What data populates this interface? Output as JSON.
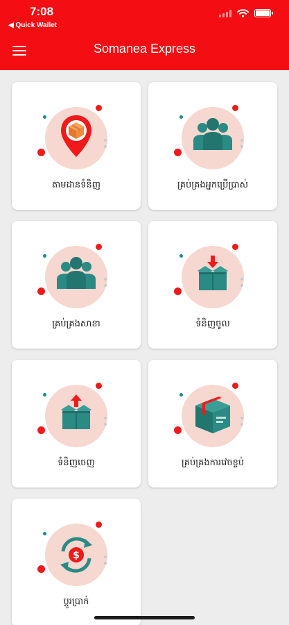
{
  "status_bar": {
    "time": "7:08",
    "back_app": "◀ Quick Wallet"
  },
  "header": {
    "title": "Somanea Express",
    "menu_icon": "hamburger-menu-icon"
  },
  "colors": {
    "brand_red": "#f40d12",
    "teal": "#2a8a84",
    "circle_bg": "#f6d8d0"
  },
  "menu": [
    {
      "label": "តាមដានទំនិញ",
      "icon": "parcel-location-icon"
    },
    {
      "label": "គ្រប់គ្រងអ្នកប្រើប្រាស់",
      "icon": "users-group-icon"
    },
    {
      "label": "គ្រប់គ្រងសាខា",
      "icon": "users-group-icon"
    },
    {
      "label": "ទំនិញចូល",
      "icon": "box-in-icon"
    },
    {
      "label": "ទំនិញចេញ",
      "icon": "box-out-icon"
    },
    {
      "label": "គ្រប់គ្រងការវេចខ្ចប់",
      "icon": "package-box-icon"
    },
    {
      "label": "ប្តូរប្រាក់",
      "icon": "money-exchange-icon"
    }
  ]
}
